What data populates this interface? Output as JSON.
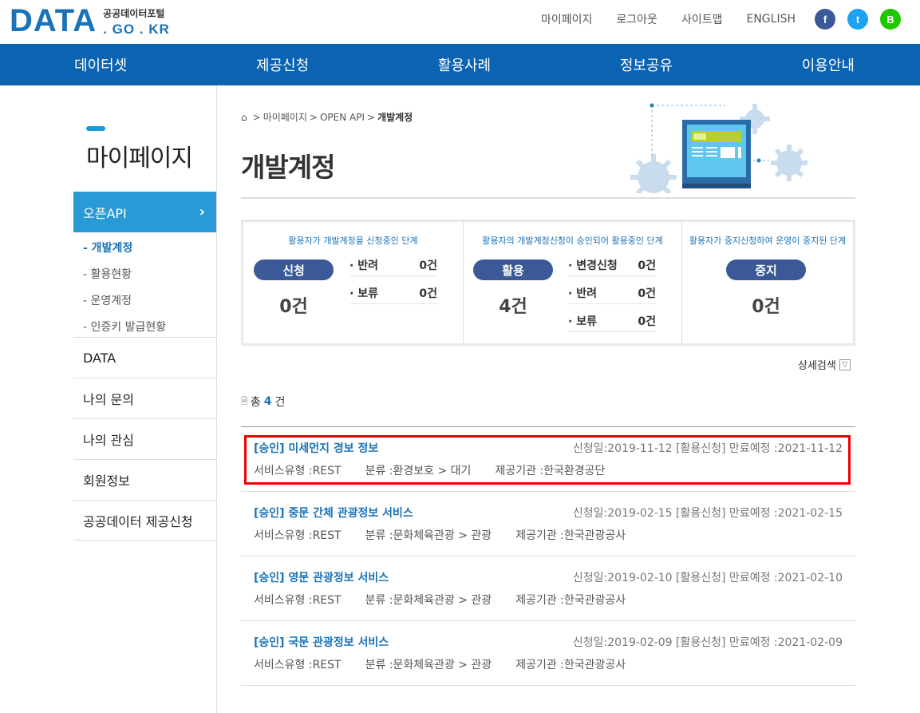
{
  "header": {
    "logo_main": "DATA",
    "logo_kor": "공공데이터포털",
    "logo_domain": ". GO . KR",
    "util_links": [
      "마이페이지",
      "로그아웃",
      "사이트맵",
      "ENGLISH"
    ],
    "sns": [
      "f",
      "t",
      "B"
    ]
  },
  "gnb": [
    "데이터셋",
    "제공신청",
    "활용사례",
    "정보공유",
    "이용안내"
  ],
  "lnb": {
    "title": "마이페이지",
    "active": "오픈API",
    "sub_items": [
      "- 개발계정",
      "- 활용현황",
      "- 운영계정",
      "- 인증키 발급현황"
    ],
    "menu": [
      "DATA",
      "나의 문의",
      "나의 관심",
      "회원정보",
      "공공데이터 제공신청"
    ]
  },
  "breadcrumb": [
    "마이페이지",
    "OPEN API",
    "개발계정"
  ],
  "page_title": "개발계정",
  "stats": [
    {
      "desc": "활용자가 개발계정을 신청중인 단계",
      "label": "신청",
      "count": "0건",
      "subs": [
        {
          "label": "· 반려",
          "value": "0건"
        },
        {
          "label": "· 보류",
          "value": "0건"
        }
      ]
    },
    {
      "desc": "활용자의 개발계정신청이 승인되어 활용중인 단계",
      "label": "활용",
      "count": "4건",
      "subs": [
        {
          "label": "· 변경신청",
          "value": "0건"
        },
        {
          "label": "· 반려",
          "value": "0건"
        },
        {
          "label": "· 보류",
          "value": "0건"
        }
      ]
    },
    {
      "desc": "활용자가 중지신청하여 운영이 중지된 단계",
      "label": "중지",
      "count": "0건",
      "subs": []
    }
  ],
  "detail_search": "상세검색",
  "total": {
    "prefix": "총",
    "count": "4",
    "suffix": "건"
  },
  "list": [
    {
      "title": "[승인] 미세먼지 경보 정보",
      "date": "신청일:2019-11-12 [활용신청] 만료예정 :2021-11-12",
      "type": "서비스유형 :REST",
      "category": "분류 :환경보호 > 대기",
      "org": "제공기관 :한국환경공단",
      "highlight": true
    },
    {
      "title": "[승인] 중문 간체 관광정보 서비스",
      "date": "신청일:2019-02-15 [활용신청] 만료예정 :2021-02-15",
      "type": "서비스유형 :REST",
      "category": "분류 :문화체육관광 > 관광",
      "org": "제공기관 :한국관광공사",
      "highlight": false
    },
    {
      "title": "[승인] 영문 관광정보 서비스",
      "date": "신청일:2019-02-10 [활용신청] 만료예정 :2021-02-10",
      "type": "서비스유형 :REST",
      "category": "분류 :문화체육관광 > 관광",
      "org": "제공기관 :한국관광공사",
      "highlight": false
    },
    {
      "title": "[승인] 국문 관광정보 서비스",
      "date": "신청일:2019-02-09 [활용신청] 만료예정 :2021-02-09",
      "type": "서비스유형 :REST",
      "category": "분류 :문화체육관광 > 관광",
      "org": "제공기관 :한국관광공사",
      "highlight": false
    }
  ],
  "colors": {
    "brand": "#0b63b1",
    "accent": "#2a9ad6",
    "pill": "#3b5996",
    "highlight": "#e00000"
  }
}
